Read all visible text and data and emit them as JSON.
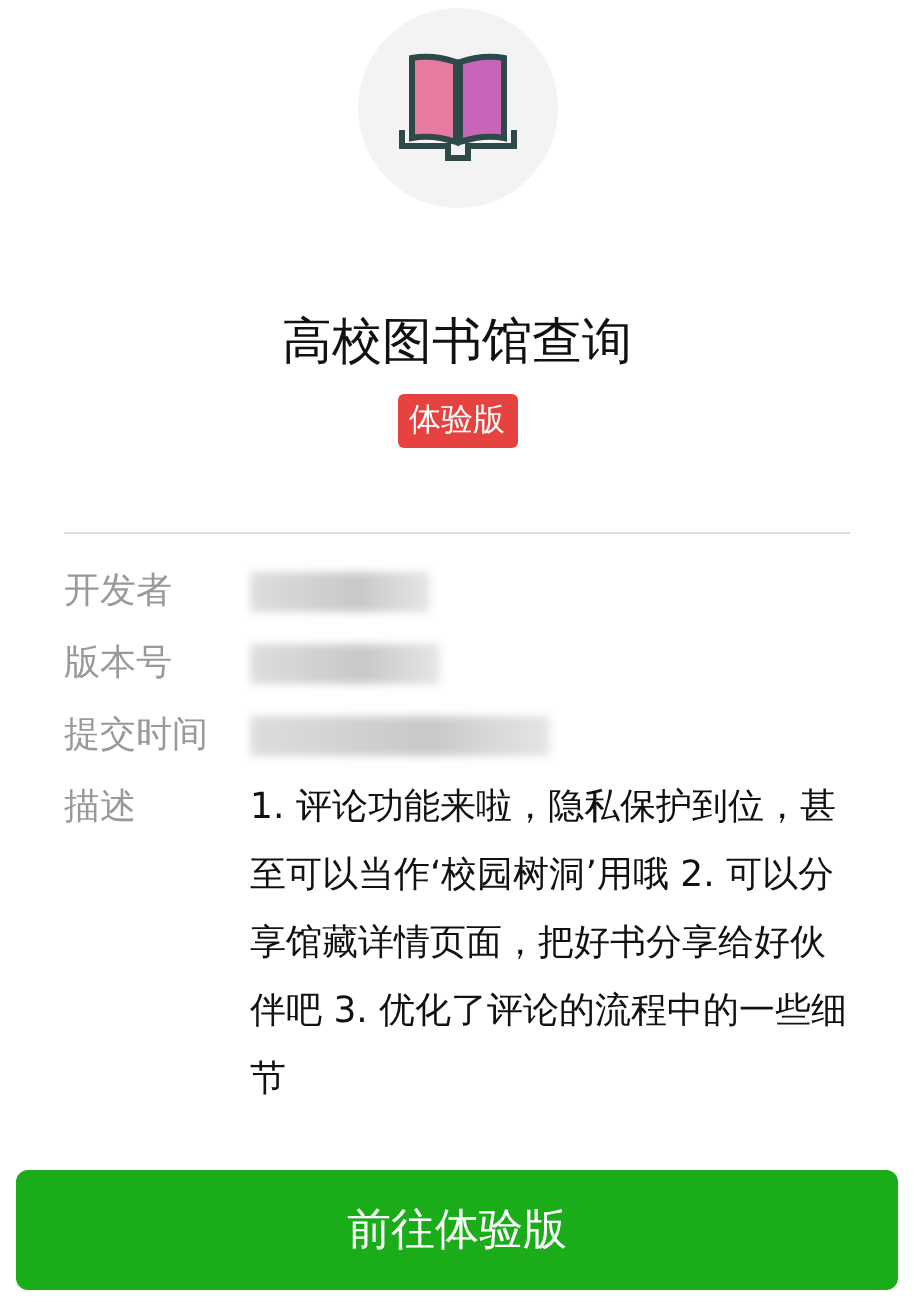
{
  "app": {
    "title": "高校图书馆查询",
    "badge": "体验版"
  },
  "info": [
    {
      "label": "开发者",
      "kind": "redacted"
    },
    {
      "label": "版本号",
      "kind": "redacted"
    },
    {
      "label": "提交时间",
      "kind": "redacted"
    },
    {
      "label": "描述",
      "kind": "text",
      "value": "1. 评论功能来啦，隐私保护到位，甚至可以当作‘校园树洞’用哦 2. 可以分享馆藏详情页面，把好书分享给好伙伴吧 3. 优化了评论的流程中的一些细节"
    }
  ],
  "button": "前往体验版"
}
